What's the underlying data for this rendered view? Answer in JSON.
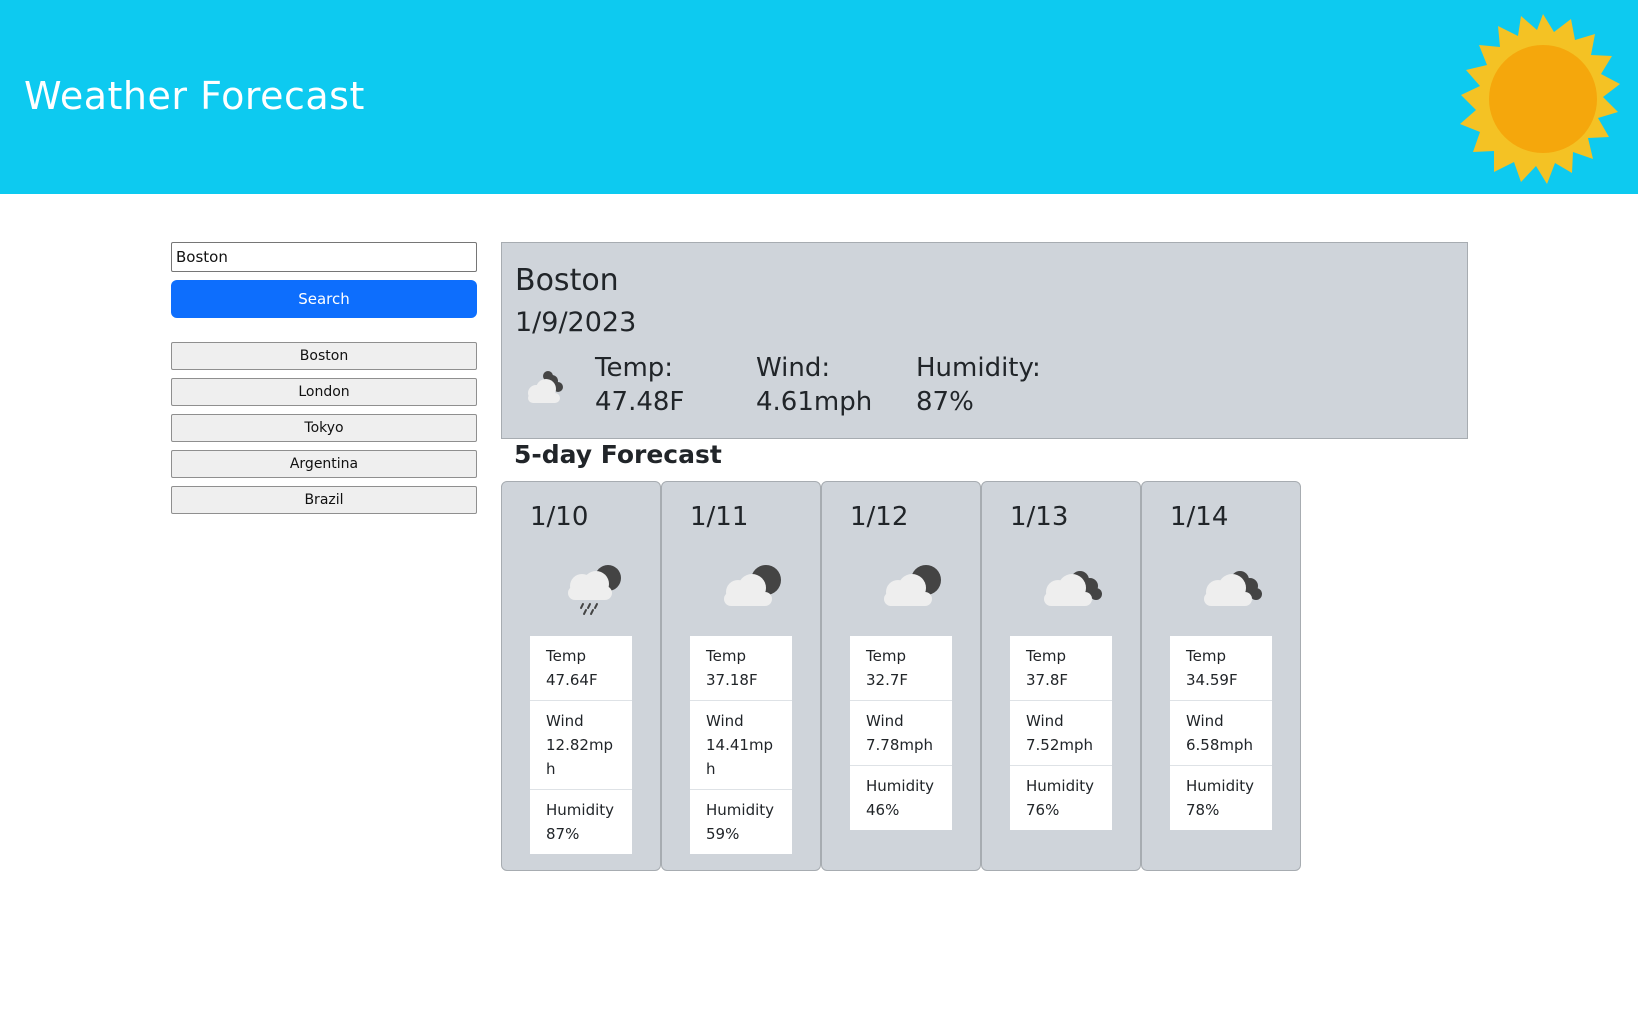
{
  "header": {
    "title": "Weather Forecast"
  },
  "search": {
    "value": "Boston",
    "button_label": "Search"
  },
  "history": [
    "Boston",
    "London",
    "Tokyo",
    "Argentina",
    "Brazil"
  ],
  "current": {
    "city": "Boston",
    "date": "1/9/2023",
    "icon": "cloud-night-icon",
    "temp_label": "Temp:",
    "temp": "47.48F",
    "wind_label": "Wind:",
    "wind": "4.61mph",
    "humidity_label": "Humidity:",
    "humidity": "87%"
  },
  "forecast_title": "5-day Forecast",
  "forecast": [
    {
      "date": "1/10",
      "icon": "rain-night-icon",
      "temp_label": "Temp",
      "temp": "47.64F",
      "wind_label": "Wind",
      "wind": "12.82mph",
      "humidity_label": "Humidity",
      "humidity": "87%"
    },
    {
      "date": "1/11",
      "icon": "partly-cloudy-night-icon",
      "temp_label": "Temp",
      "temp": "37.18F",
      "wind_label": "Wind",
      "wind": "14.41mph",
      "humidity_label": "Humidity",
      "humidity": "59%"
    },
    {
      "date": "1/12",
      "icon": "partly-cloudy-night-icon",
      "temp_label": "Temp",
      "temp": "32.7F",
      "wind_label": "Wind",
      "wind": "7.78mph",
      "humidity_label": "Humidity",
      "humidity": "46%"
    },
    {
      "date": "1/13",
      "icon": "cloudy-night-icon",
      "temp_label": "Temp",
      "temp": "37.8F",
      "wind_label": "Wind",
      "wind": "7.52mph",
      "humidity_label": "Humidity",
      "humidity": "76%"
    },
    {
      "date": "1/14",
      "icon": "cloudy-night-icon",
      "temp_label": "Temp",
      "temp": "34.59F",
      "wind_label": "Wind",
      "wind": "6.58mph",
      "humidity_label": "Humidity",
      "humidity": "78%"
    }
  ],
  "colors": {
    "header": "#0dcaf0",
    "search_button": "#0d6efd",
    "panel": "#cfd4da",
    "sun_outer": "#f4c224",
    "sun_inner": "#f5a70c"
  }
}
